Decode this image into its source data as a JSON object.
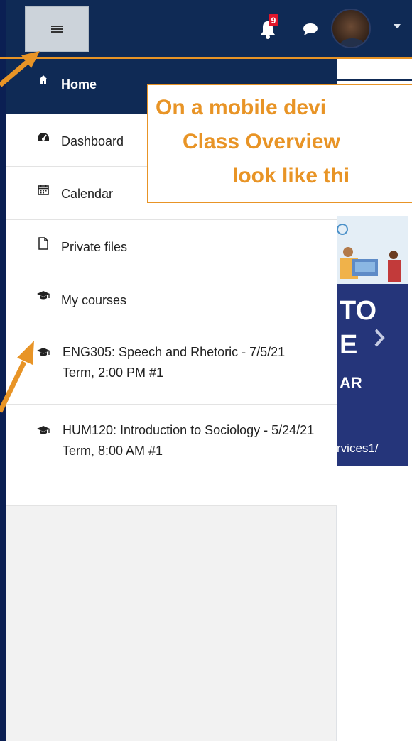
{
  "navbar": {
    "menu_icon": "hamburger-icon",
    "notification_count": "9",
    "notification_icon": "bell-icon",
    "messages_icon": "chat-bubble-icon",
    "user_menu_icon": "caret-down-icon"
  },
  "drawer": {
    "items": [
      {
        "icon": "home-icon",
        "label": "Home"
      },
      {
        "icon": "dashboard-icon",
        "label": "Dashboard"
      },
      {
        "icon": "calendar-icon",
        "label": "Calendar"
      },
      {
        "icon": "file-icon",
        "label": "Private files"
      },
      {
        "icon": "graduation-cap-icon",
        "label": "My courses"
      },
      {
        "icon": "graduation-cap-icon",
        "label": "ENG305: Speech and Rhetoric - 7/5/21 Term, 2:00 PM #1"
      },
      {
        "icon": "graduation-cap-icon",
        "label": "HUM120: Introduction to Sociology - 5/24/21 Term, 8:00 AM #1"
      }
    ]
  },
  "banner": {
    "line1": "TO",
    "line2": "E",
    "line3": "AR",
    "url": "rvices1/"
  },
  "callout": {
    "line1": "On a mobile devi",
    "line2": "Class Overview",
    "line3": "look like thi"
  },
  "colors": {
    "navbar": "#0f2a55",
    "background": "#0b1f53",
    "accent": "#e89426",
    "badge": "#e0162b"
  }
}
